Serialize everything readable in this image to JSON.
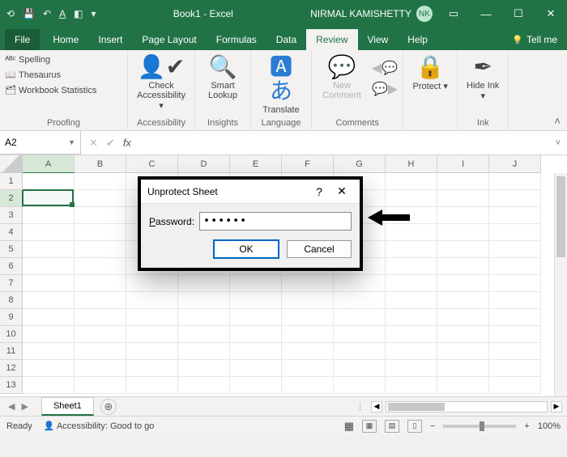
{
  "titlebar": {
    "doc_title": "Book1 - Excel",
    "user_name": "NIRMAL KAMISHETTY",
    "user_initials": "NK"
  },
  "tabs": {
    "file": "File",
    "home": "Home",
    "insert": "Insert",
    "page_layout": "Page Layout",
    "formulas": "Formulas",
    "data": "Data",
    "review": "Review",
    "view": "View",
    "help": "Help",
    "tell_me": "Tell me"
  },
  "ribbon": {
    "proofing": {
      "spelling": "Spelling",
      "thesaurus": "Thesaurus",
      "workbook_stats": "Workbook Statistics",
      "group_label": "Proofing"
    },
    "accessibility": {
      "check": "Check Accessibility ▾",
      "group_label": "Accessibility"
    },
    "insights": {
      "smart_lookup": "Smart Lookup",
      "group_label": "Insights"
    },
    "language": {
      "translate": "Translate",
      "group_label": "Language"
    },
    "comments": {
      "new_comment": "New Comment",
      "group_label": "Comments"
    },
    "protect": {
      "protect": "Protect ▾",
      "group_label": ""
    },
    "ink": {
      "hide_ink": "Hide Ink ▾",
      "group_label": "Ink"
    }
  },
  "fx": {
    "cell_ref": "A2",
    "formula": ""
  },
  "grid": {
    "columns": [
      "A",
      "B",
      "C",
      "D",
      "E",
      "F",
      "G",
      "H",
      "I",
      "J"
    ],
    "rows": [
      "1",
      "2",
      "3",
      "4",
      "5",
      "6",
      "7",
      "8",
      "9",
      "10",
      "11",
      "12",
      "13"
    ],
    "selected_cell_col": 0,
    "selected_cell_row": 1
  },
  "sheets": {
    "active": "Sheet1"
  },
  "statusbar": {
    "ready": "Ready",
    "accessibility": "Accessibility: Good to go",
    "zoom": "100%"
  },
  "dialog": {
    "title": "Unprotect Sheet",
    "password_label_pre": "P",
    "password_label_rest": "assword:",
    "password_value_masked": "••••••",
    "ok": "OK",
    "cancel": "Cancel"
  }
}
